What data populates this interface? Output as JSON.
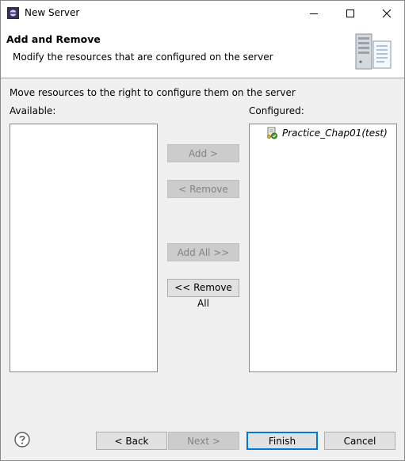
{
  "window": {
    "title": "New Server"
  },
  "banner": {
    "title": "Add and Remove",
    "description": "Modify the resources that are configured on the server"
  },
  "body": {
    "instruction": "Move resources to the right to configure them on the server",
    "available_label": "Available:",
    "configured_label": "Configured:",
    "available_items": [],
    "configured_items": [
      {
        "label": "Practice_Chap01(test)",
        "icon": "web-module-icon"
      }
    ]
  },
  "buttons": {
    "add": "Add >",
    "remove": "< Remove",
    "add_all": "Add All >>",
    "remove_all": "<< Remove All",
    "back": "< Back",
    "next": "Next >",
    "finish": "Finish",
    "cancel": "Cancel"
  },
  "colors": {
    "accent": "#0078d7",
    "disabled_text": "#838383"
  }
}
